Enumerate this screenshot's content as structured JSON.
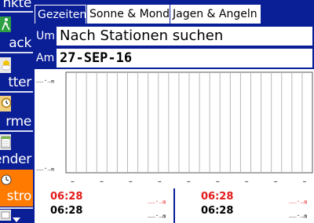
{
  "sidebar": {
    "items": [
      {
        "label": "nkte",
        "icon": "partial-icon"
      },
      {
        "label": "ack",
        "icon": "hiker-icon"
      },
      {
        "label": "tter",
        "icon": "weather-icon"
      },
      {
        "label": "rme",
        "icon": "alarm-clock-icon"
      },
      {
        "label": "ender",
        "icon": "calendar-icon"
      },
      {
        "label": "stro",
        "icon": "astro-clock-icon",
        "active": true
      }
    ],
    "active_color": "#ff7a00"
  },
  "tabs": [
    {
      "label": "Gezeiten",
      "active": true
    },
    {
      "label": "Sonne & Mond",
      "active": false
    },
    {
      "label": "Jagen & Angeln",
      "active": false
    }
  ],
  "location": {
    "label": "Um",
    "value": "Nach Stationen suchen"
  },
  "date": {
    "label": "Am",
    "value": "27-SEP-16"
  },
  "graph": {
    "y_top_label": "__._",
    "y_bottom_label": "__._",
    "y_unit": "m",
    "x_tick_marks": [
      "–",
      "–",
      "–",
      "–",
      "–",
      "–",
      "–",
      "–",
      "–"
    ]
  },
  "bottom": {
    "columns": [
      {
        "time_red": "06:28",
        "value_red": "__._",
        "unit_red": "m",
        "time_black": "06:28",
        "value_black": "__._",
        "unit_black": "m"
      },
      {
        "time_red": "06:28",
        "value_red": "__._",
        "unit_red": "m",
        "time_black": "06:28",
        "value_black": "__._",
        "unit_black": "m"
      }
    ]
  },
  "colors": {
    "background": "#0a1e96",
    "red": "#e21b1b",
    "white": "#ffffff"
  }
}
